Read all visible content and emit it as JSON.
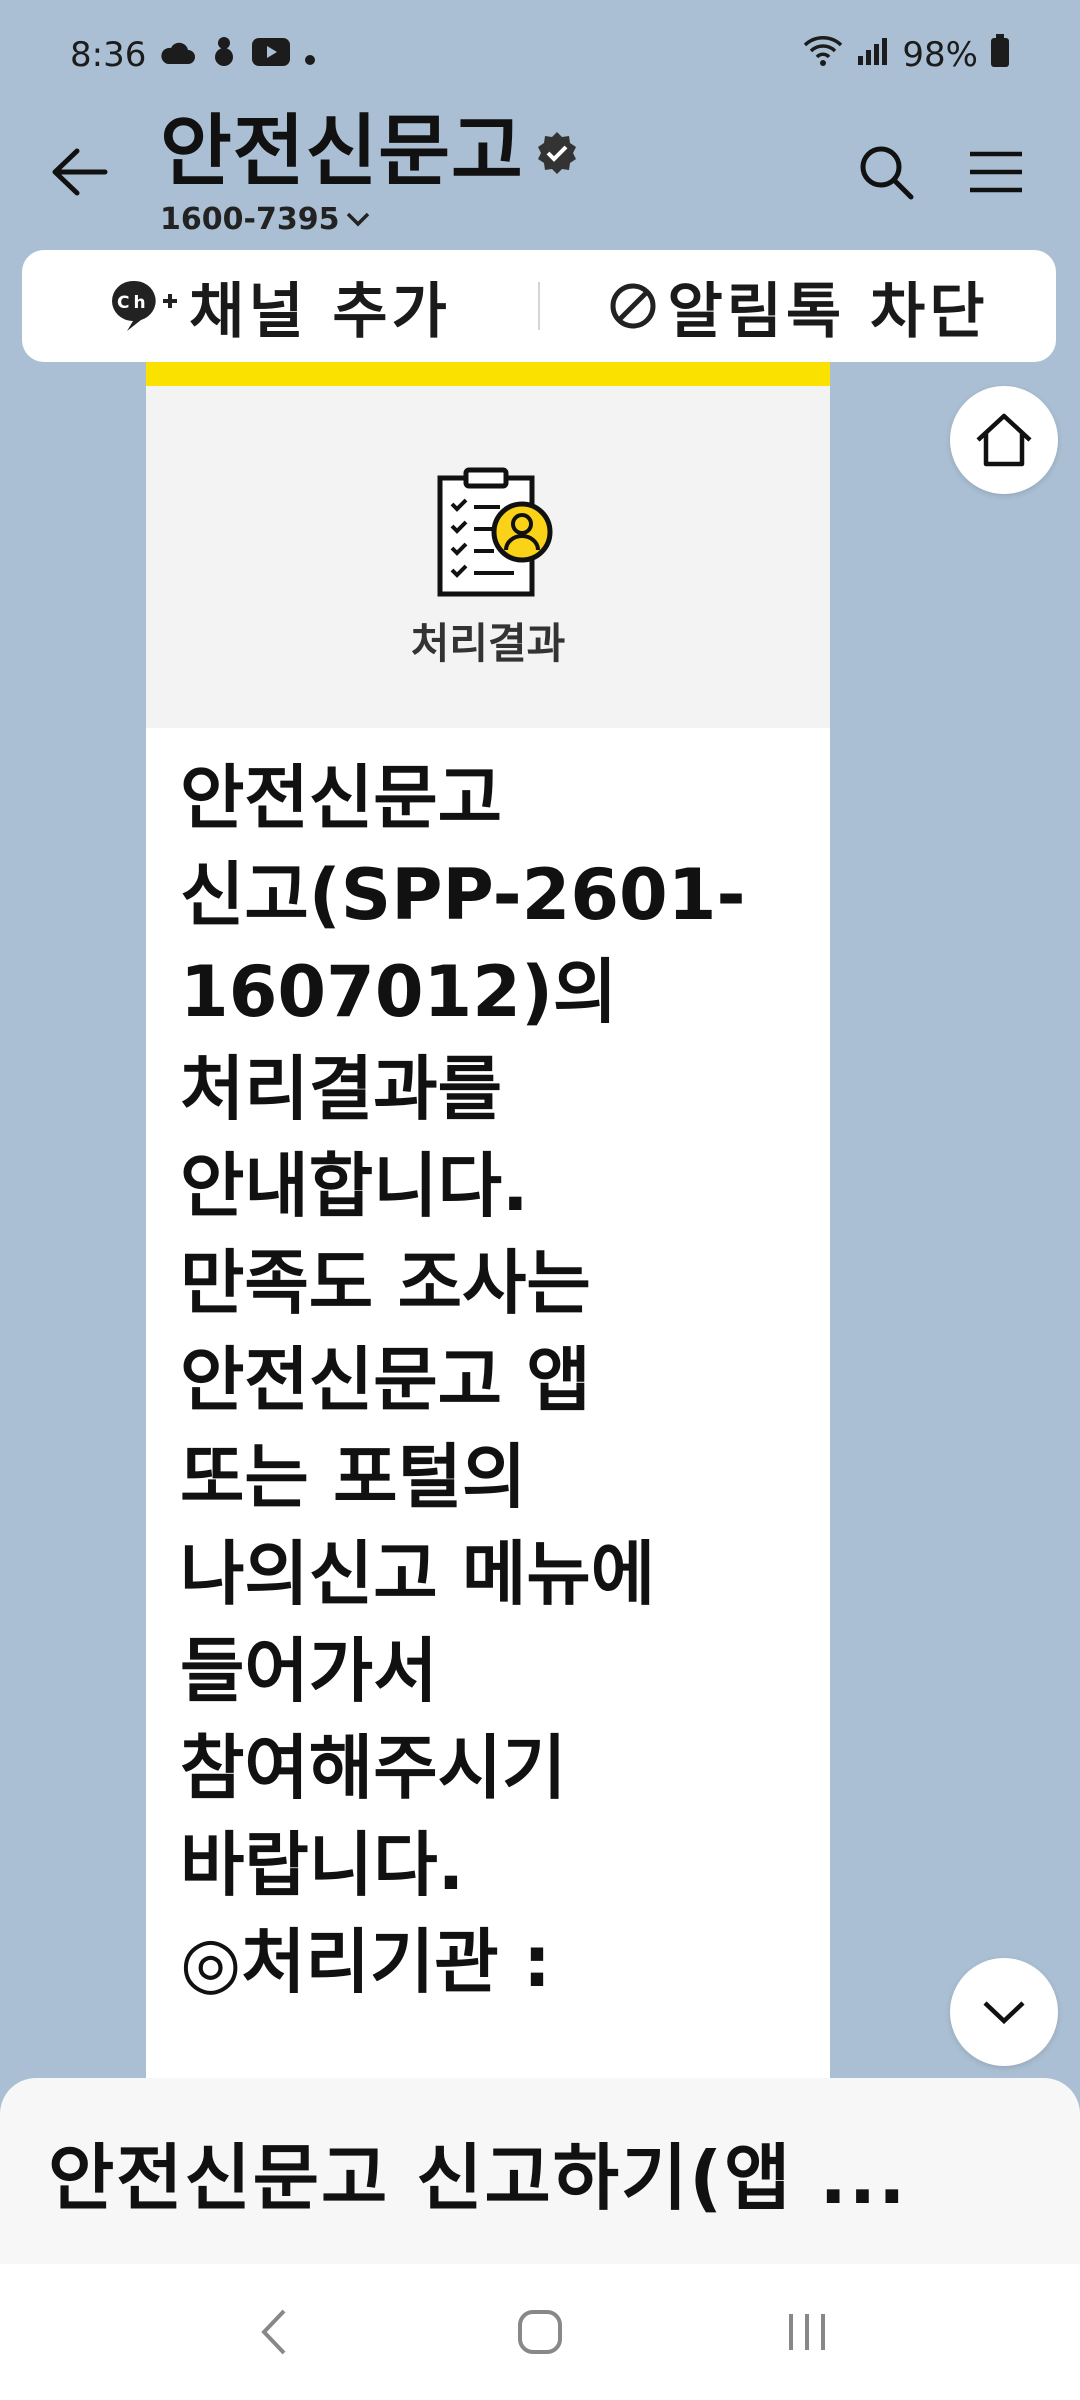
{
  "status_bar": {
    "time": "8:36",
    "battery": "98%",
    "icons": [
      "cloud-icon",
      "snowman-icon",
      "youtube-icon",
      "dot-icon",
      "wifi-icon",
      "signal-icon",
      "battery-icon"
    ]
  },
  "header": {
    "title": "안전신문고",
    "phone": "1600-7395",
    "icons": [
      "back-arrow-icon",
      "verified-badge-icon",
      "search-icon",
      "hamburger-menu-icon",
      "chevron-down-icon"
    ]
  },
  "actions": {
    "add_channel": "채널 추가",
    "block_alert": "알림톡 차단"
  },
  "card": {
    "icon_label": "처리결과",
    "body": "안전신문고\n신고(SPP-2601-\n1607012)의\n처리결과를\n안내합니다.\n만족도 조사는\n안전신문고 앱\n또는 포털의\n나의신고 메뉴에\n들어가서\n참여해주시기\n바랍니다.\n◎처리기관 :"
  },
  "bottom": {
    "text": "안전신문고 신고하기(앱 ..."
  },
  "colors": {
    "background": "#aabfd3",
    "accent": "#fae100"
  }
}
